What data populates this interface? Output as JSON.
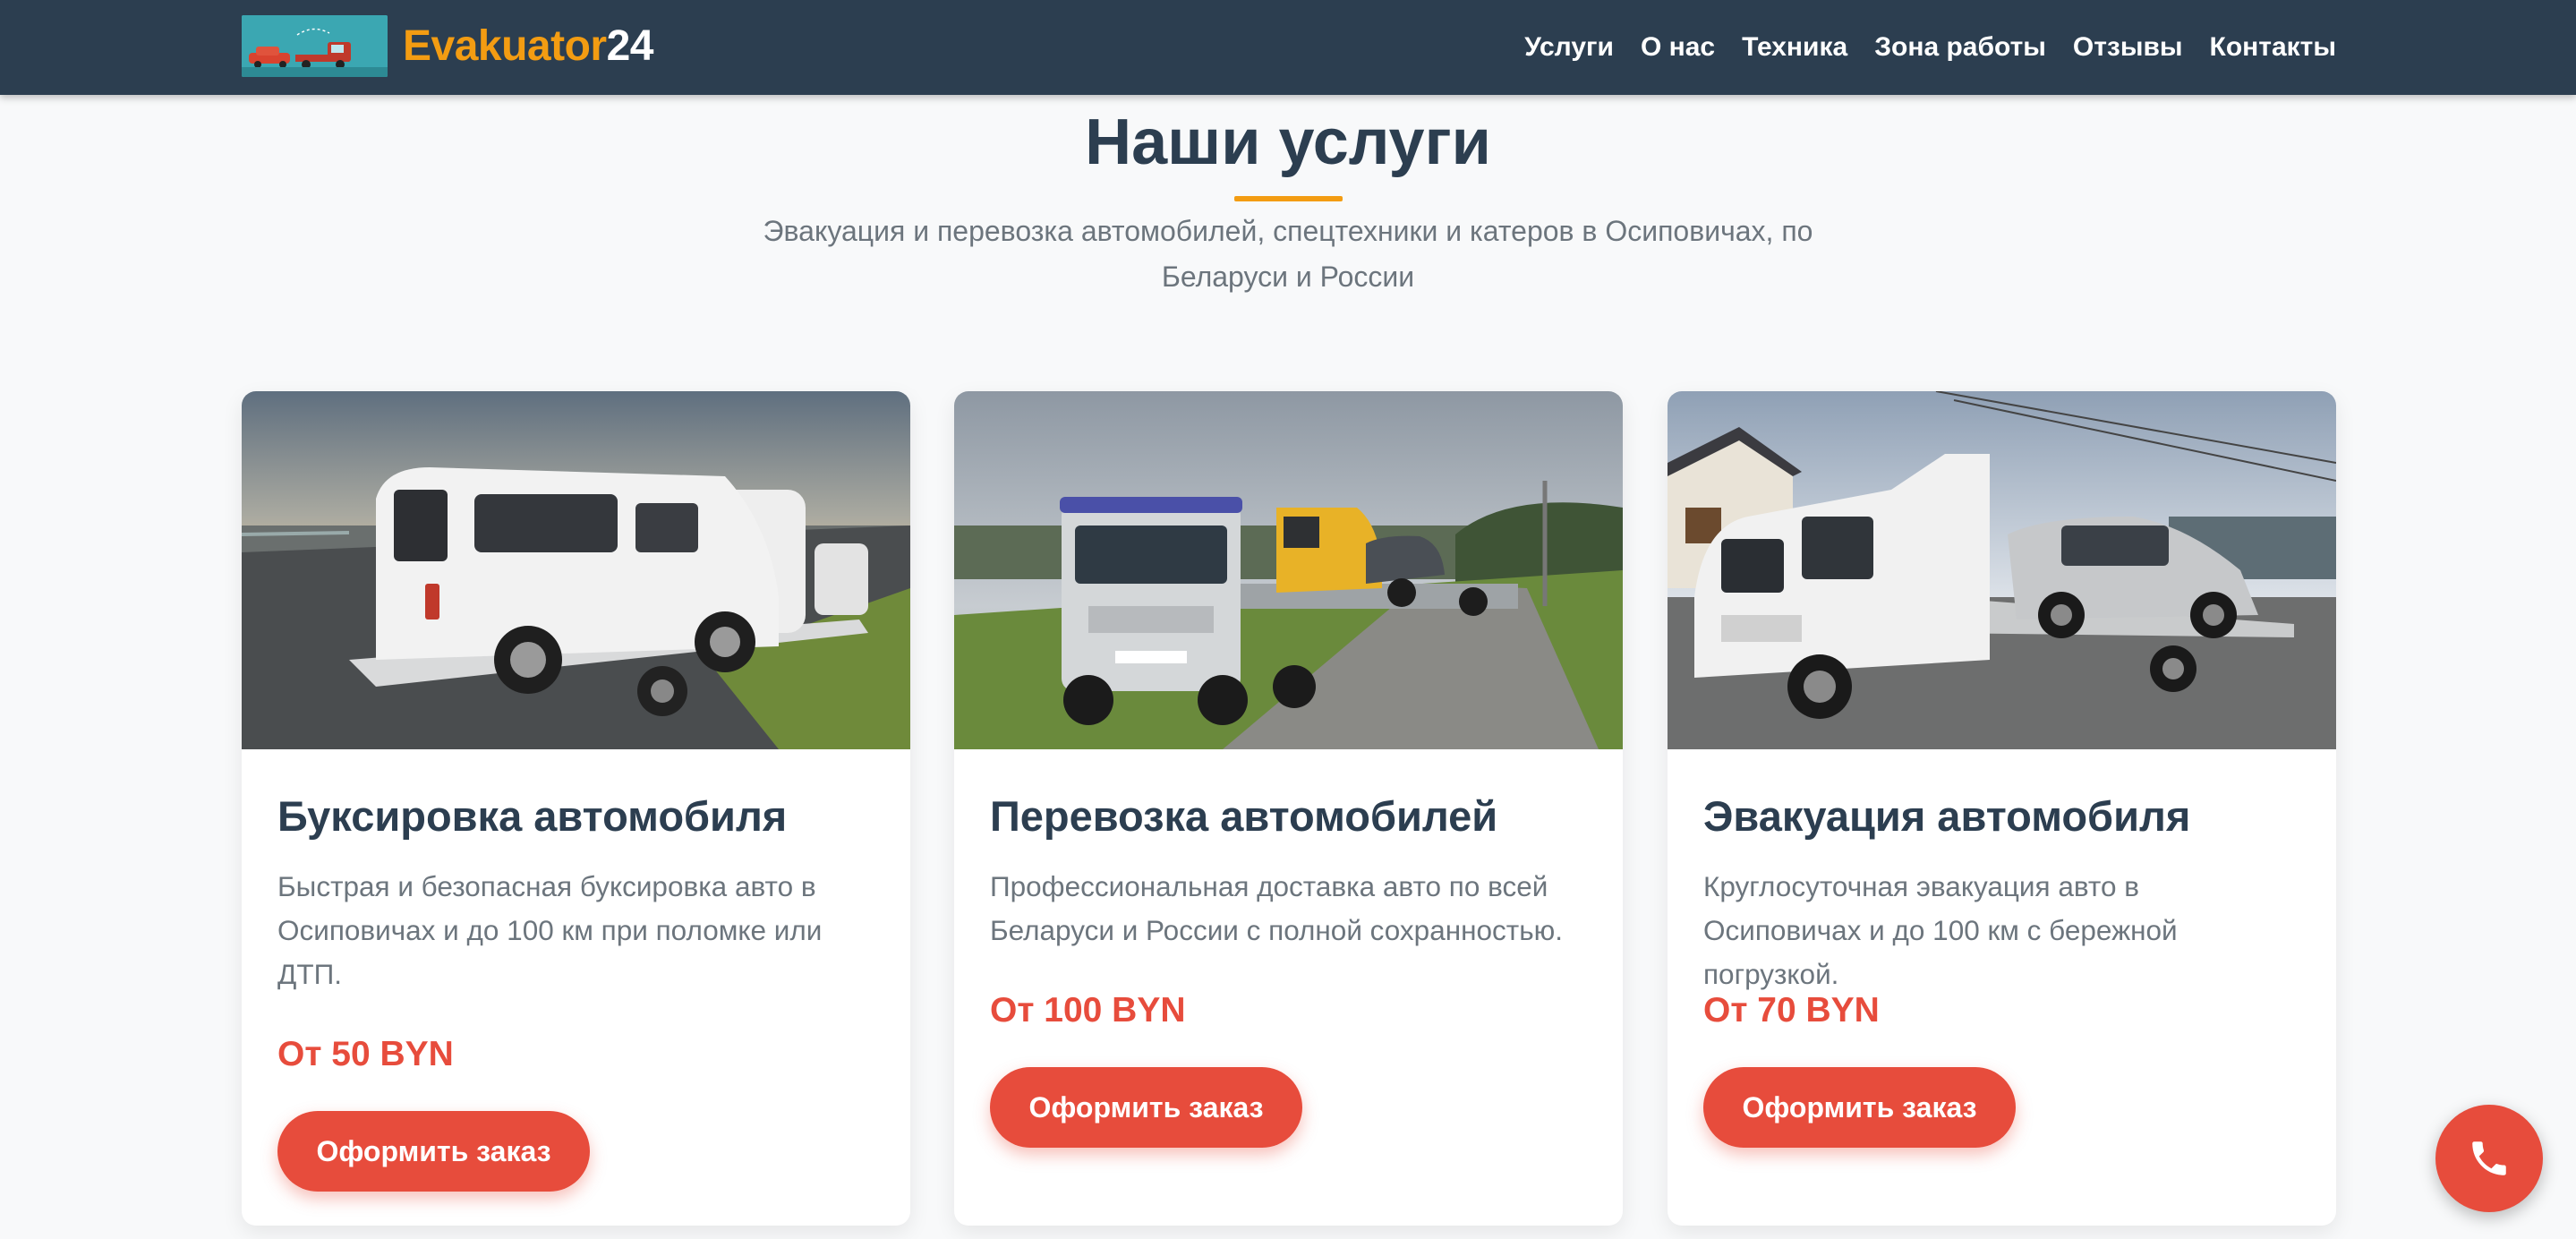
{
  "header": {
    "logo_text_part1": "Evakuator",
    "logo_text_part2": "24",
    "nav": [
      "Услуги",
      "О нас",
      "Техника",
      "Зона работы",
      "Отзывы",
      "Контакты"
    ]
  },
  "services": {
    "title": "Наши услуги",
    "subtitle": "Эвакуация и перевозка автомобилей, спецтехники и катеров в Осиповичах, по Беларуси и России",
    "cards": [
      {
        "title": "Буксировка автомобиля",
        "description": "Быстрая и безопасная буксировка авто в Осиповичах и до 100 км при поломке или ДТП.",
        "price": "От 50 BYN",
        "button": "Оформить заказ"
      },
      {
        "title": "Перевозка автомобилей",
        "description": "Профессиональная доставка авто по всей Беларуси и России с полной сохранностью.",
        "price": "От 100 BYN",
        "button": "Оформить заказ"
      },
      {
        "title": "Эвакуация автомобиля",
        "description": "Круглосуточная эвакуация авто в Осиповичах и до 100 км с бережной погрузкой.",
        "price": "От 70 BYN",
        "button": "Оформить заказ"
      }
    ]
  },
  "floating": {
    "icon": "phone-icon"
  },
  "colors": {
    "header_bg": "#2c3e50",
    "accent": "#f39c12",
    "button": "#e74c3c",
    "page_bg": "#f8f9fa"
  }
}
